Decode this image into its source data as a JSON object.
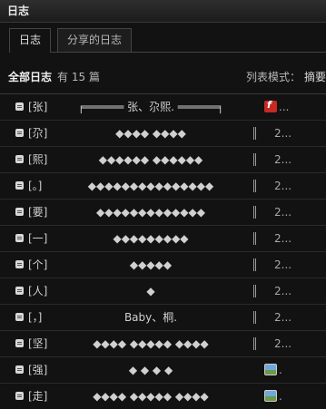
{
  "window": {
    "title": "日志"
  },
  "tabs": [
    {
      "label": "日志"
    },
    {
      "label": "分享的日志"
    }
  ],
  "summary": {
    "all_label": "全部日志",
    "count_text": "有 15 篇",
    "mode_label": "列表模式：",
    "mode_value": "摘要"
  },
  "rows": [
    {
      "ch": "[张]",
      "deco": "╒══════ 张、尕熙. ══════╕",
      "date": "...",
      "badge": "flash"
    },
    {
      "ch": "[尕]",
      "deco": "◆◆◆◆    ◆◆◆◆",
      "date": "2..."
    },
    {
      "ch": "[熙]",
      "deco": "◆◆◆◆◆◆  ◆◆◆◆◆◆",
      "date": "2..."
    },
    {
      "ch": "[。]",
      "deco": "◆◆◆◆◆◆◆◆◆◆◆◆◆◆◆",
      "date": "2..."
    },
    {
      "ch": "[要]",
      "deco": "◆◆◆◆◆◆◆◆◆◆◆◆◆",
      "date": "2..."
    },
    {
      "ch": "[一]",
      "deco": "◆◆◆◆◆◆◆◆◆",
      "date": "2..."
    },
    {
      "ch": "[个]",
      "deco": "◆◆◆◆◆",
      "date": "2..."
    },
    {
      "ch": "[人]",
      "deco": "◆",
      "date": "2..."
    },
    {
      "ch": "[，]",
      "deco": "Baby、桐.",
      "date": "2..."
    },
    {
      "ch": "[坚]",
      "deco": "◆◆◆◆ ◆◆◆◆◆ ◆◆◆◆",
      "date": "2..."
    },
    {
      "ch": "[强]",
      "deco": "◆         ◆  ◆   ◆",
      "date": ".",
      "badge": "img"
    },
    {
      "ch": "[走]",
      "deco": "◆◆◆◆ ◆◆◆◆◆ ◆◆◆◆",
      "date": ".",
      "badge": "img"
    }
  ]
}
